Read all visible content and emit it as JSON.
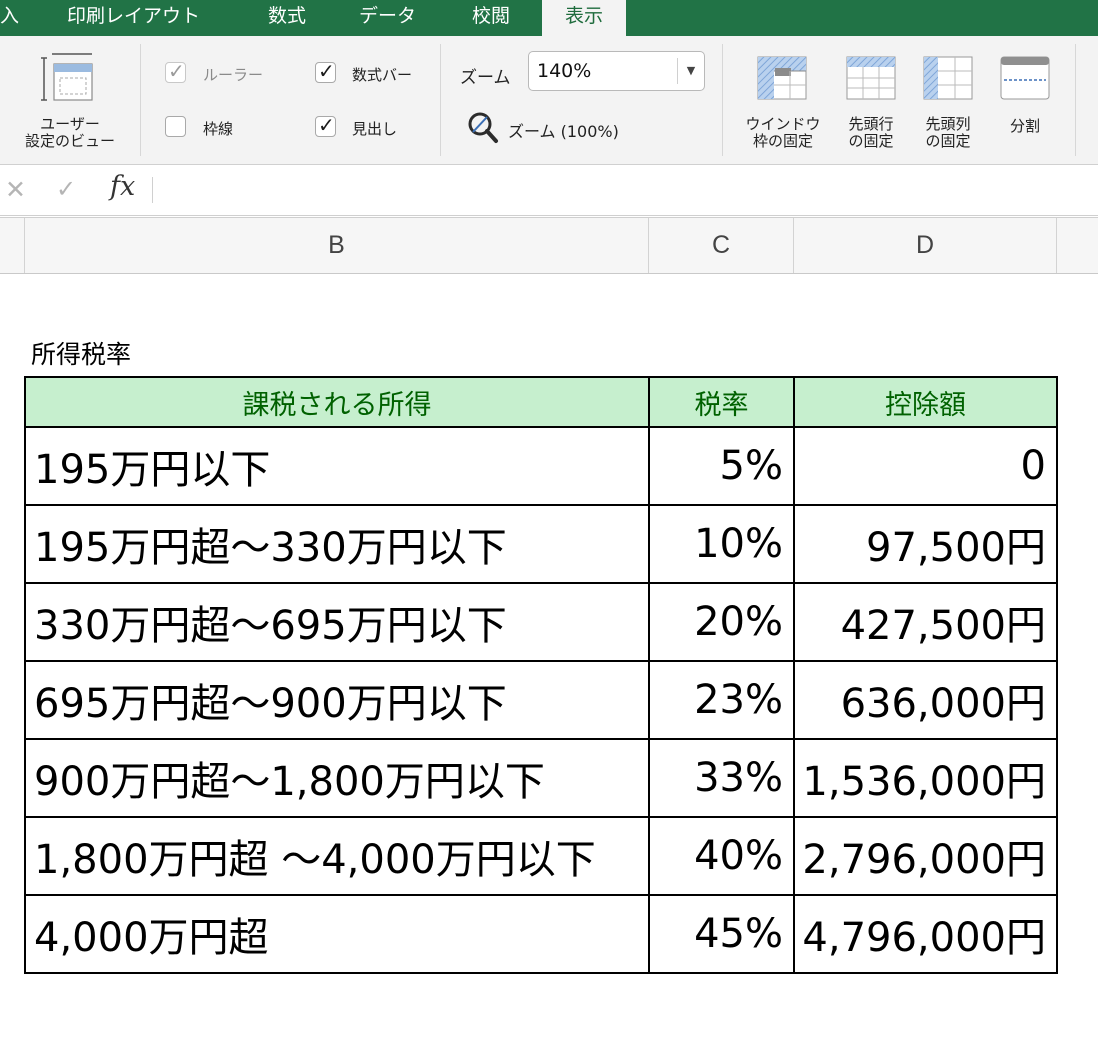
{
  "ribbon_tabs": {
    "partial": "入",
    "layout": "印刷レイアウト",
    "formulas": "数式",
    "data": "データ",
    "review": "校閲",
    "view": "表示"
  },
  "ribbon": {
    "custom_views_line1": "ユーザー",
    "custom_views_line2": "設定のビュー",
    "ruler": "ルーラー",
    "gridlines": "枠線",
    "formula_bar": "数式バー",
    "headings": "見出し",
    "zoom_label": "ズーム",
    "zoom_value": "140%",
    "zoom_100": "ズーム (100%)",
    "freeze_panes_line1": "ウインドウ",
    "freeze_panes_line2": "枠の固定",
    "freeze_top_row_line1": "先頭行",
    "freeze_top_row_line2": "の固定",
    "freeze_first_col_line1": "先頭列",
    "freeze_first_col_line2": "の固定",
    "split": "分割",
    "ruler_checked": true,
    "gridlines_checked": false,
    "formula_bar_checked": true,
    "headings_checked": true
  },
  "formula_bar": {
    "cancel_glyph": "✕",
    "enter_glyph": "✓",
    "fx_glyph": "fx"
  },
  "columns": [
    "B",
    "C",
    "D"
  ],
  "sheet": {
    "title": "所得税率",
    "headers": [
      "課税される所得",
      "税率",
      "控除額"
    ],
    "rows": [
      [
        "195万円以下",
        "5%",
        "0"
      ],
      [
        "195万円超〜330万円以下",
        "10%",
        "97,500円"
      ],
      [
        "330万円超〜695万円以下",
        "20%",
        "427,500円"
      ],
      [
        "695万円超〜900万円以下",
        "23%",
        "636,000円"
      ],
      [
        "900万円超〜1,800万円以下",
        "33%",
        "1,536,000円"
      ],
      [
        "1,800万円超 〜4,000万円以下",
        "40%",
        "2,796,000円"
      ],
      [
        "4,000万円超",
        "45%",
        "4,796,000円"
      ]
    ]
  },
  "colors": {
    "ribbon_tab_bar": "#217346",
    "header_fill": "#c6efce",
    "header_text": "#006100"
  }
}
